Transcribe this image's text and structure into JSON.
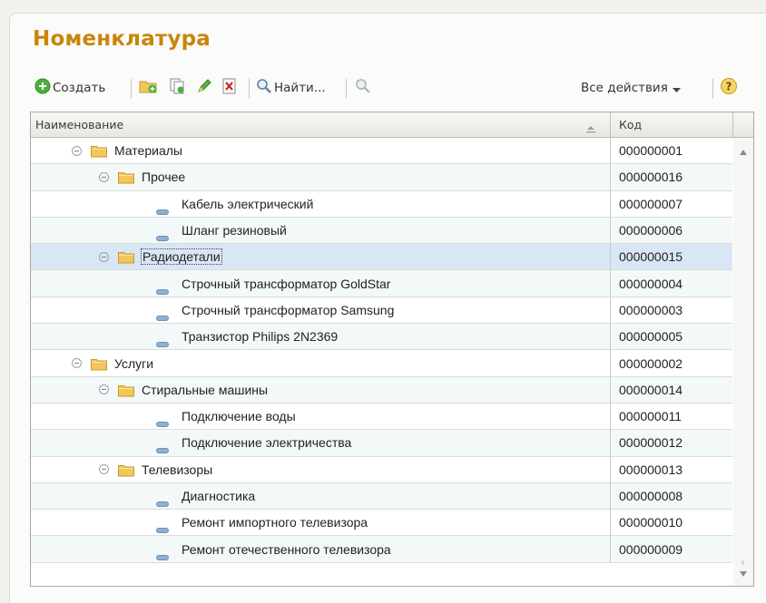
{
  "window": {
    "title": "Номенклатура"
  },
  "toolbar": {
    "create_label": "Создать",
    "find_label": "Найти...",
    "all_actions_label": "Все действия",
    "icons": [
      "add-circle-icon",
      "add-group-icon",
      "copy-icon",
      "edit-pencil-icon",
      "delete-mark-icon",
      "search-icon",
      "cancel-search-icon",
      "help-icon",
      "dropdown-arrow-icon"
    ]
  },
  "table": {
    "columns": {
      "name": "Наименование",
      "code": "Код"
    },
    "rows": [
      {
        "level": 1,
        "type": "group",
        "name": "Материалы",
        "code": "000000001"
      },
      {
        "level": 2,
        "type": "group",
        "name": "Прочее",
        "code": "000000016"
      },
      {
        "level": 3,
        "type": "item",
        "name": "Кабель электрический",
        "code": "000000007"
      },
      {
        "level": 3,
        "type": "item",
        "name": "Шланг резиновый",
        "code": "000000006"
      },
      {
        "level": 2,
        "type": "group",
        "name": "Радиодетали",
        "code": "000000015",
        "selected": true
      },
      {
        "level": 3,
        "type": "item",
        "name": "Строчный трансформатор GoldStar",
        "code": "000000004"
      },
      {
        "level": 3,
        "type": "item",
        "name": "Строчный трансформатор Samsung",
        "code": "000000003"
      },
      {
        "level": 3,
        "type": "item",
        "name": "Транзистор Philips 2N2369",
        "code": "000000005"
      },
      {
        "level": 1,
        "type": "group",
        "name": "Услуги",
        "code": "000000002"
      },
      {
        "level": 2,
        "type": "group",
        "name": "Стиральные машины",
        "code": "000000014"
      },
      {
        "level": 3,
        "type": "item",
        "name": "Подключение воды",
        "code": "000000011"
      },
      {
        "level": 3,
        "type": "item",
        "name": "Подключение электричества",
        "code": "000000012"
      },
      {
        "level": 2,
        "type": "group",
        "name": "Телевизоры",
        "code": "000000013"
      },
      {
        "level": 3,
        "type": "item",
        "name": "Диагностика",
        "code": "000000008"
      },
      {
        "level": 3,
        "type": "item",
        "name": "Ремонт импортного телевизора",
        "code": "000000010"
      },
      {
        "level": 3,
        "type": "item",
        "name": "Ремонт отечественного телевизора",
        "code": "000000009"
      }
    ]
  },
  "colors": {
    "title": "#c9850a",
    "selected_row": "#d9e6f5",
    "alt_row": "#f3f8f8",
    "folder": "#f2c75a",
    "item_dash": "#8fb0cf"
  }
}
